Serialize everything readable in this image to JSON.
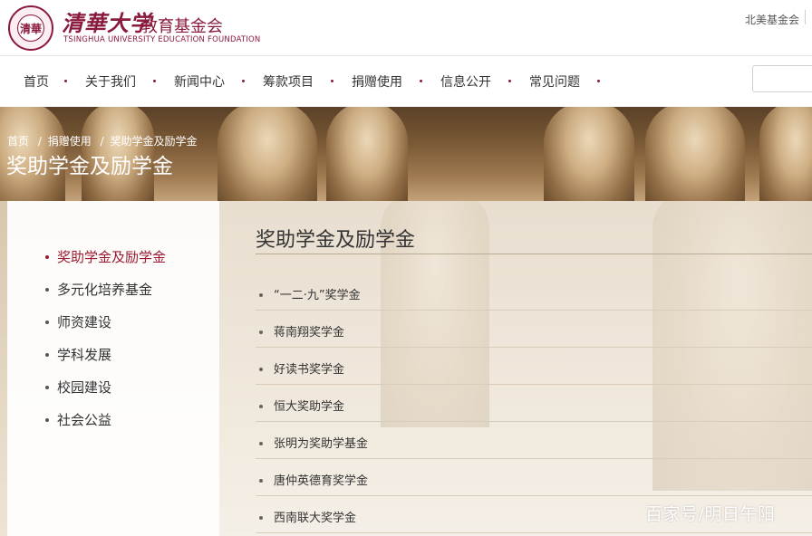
{
  "header": {
    "logo_cn": "清華大学",
    "logo_sub": "教育基金会",
    "logo_en": "TSINGHUA UNIVERSITY EDUCATION FOUNDATION",
    "seal_text": "清華",
    "top_link": "北美基金会"
  },
  "nav": {
    "items": [
      "首页",
      "关于我们",
      "新闻中心",
      "筹款项目",
      "捐赠使用",
      "信息公开",
      "常见问题"
    ]
  },
  "banner": {
    "breadcrumb": [
      "首页",
      "捐赠使用",
      "奖助学金及励学金"
    ],
    "breadcrumb_sep": "/",
    "title": "奖助学金及励学金"
  },
  "sidebar": {
    "items": [
      {
        "label": "奖助学金及励学金",
        "active": true
      },
      {
        "label": "多元化培养基金",
        "active": false
      },
      {
        "label": "师资建设",
        "active": false
      },
      {
        "label": "学科发展",
        "active": false
      },
      {
        "label": "校园建设",
        "active": false
      },
      {
        "label": "社会公益",
        "active": false
      }
    ]
  },
  "main": {
    "title": "奖助学金及励学金",
    "items": [
      "“一二·九”奖学金",
      "蒋南翔奖学金",
      "好读书奖学金",
      "恒大奖助学金",
      "张明为奖助学基金",
      "唐仲英德育奖学金",
      "西南联大奖学金"
    ]
  },
  "watermark": "百家号/明日午阳",
  "colors": {
    "brand": "#8a1a3c",
    "active": "#9d1a30"
  }
}
